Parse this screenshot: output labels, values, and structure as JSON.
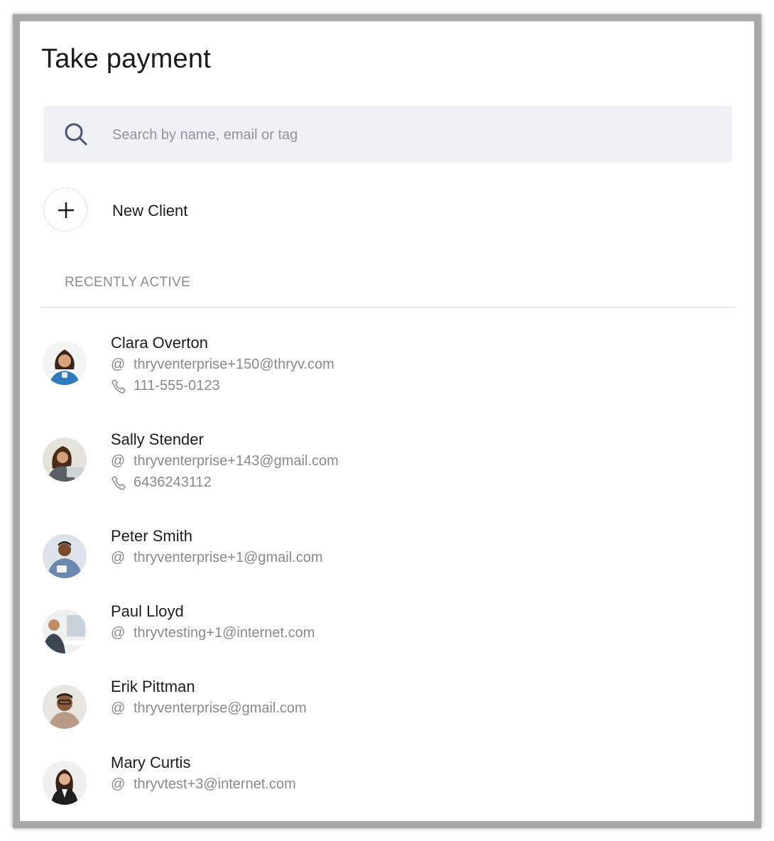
{
  "header": {
    "title": "Take payment"
  },
  "search": {
    "placeholder": "Search by name, email or tag",
    "value": ""
  },
  "new_client": {
    "label": "New Client"
  },
  "recent": {
    "section_label": "RECENTLY ACTIVE",
    "clients": [
      {
        "name": "Clara Overton",
        "email": "thryventerprise+150@thryv.com",
        "phone": "111-555-0123"
      },
      {
        "name": "Sally Stender",
        "email": "thryventerprise+143@gmail.com",
        "phone": "6436243112"
      },
      {
        "name": "Peter Smith",
        "email": "thryventerprise+1@gmail.com"
      },
      {
        "name": "Paul Lloyd",
        "email": "thryvtesting+1@internet.com"
      },
      {
        "name": "Erik Pittman",
        "email": "thryventerprise@gmail.com"
      },
      {
        "name": "Mary Curtis",
        "email": "thryvtest+3@internet.com"
      }
    ]
  },
  "icons": {
    "search": "search-icon",
    "plus": "plus-icon",
    "email": "at-icon",
    "phone": "phone-icon"
  },
  "colors": {
    "search_bg": "#f0f1f6",
    "search_icon": "#4a5470",
    "muted_text": "#8a8a8a",
    "primary_text": "#1c1c1c"
  }
}
